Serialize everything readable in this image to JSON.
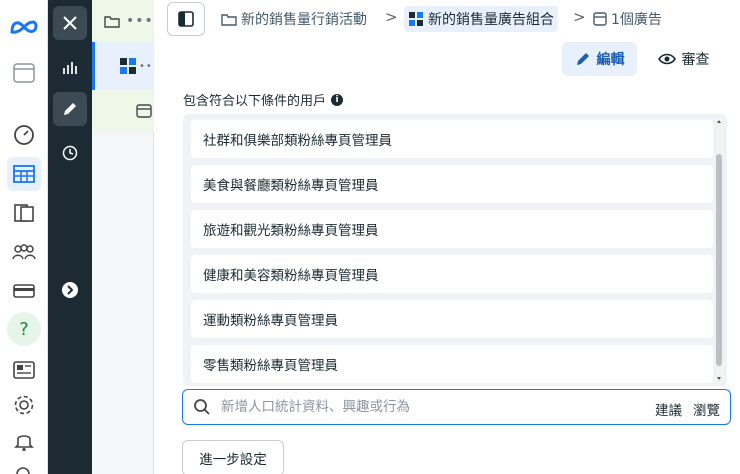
{
  "breadcrumb": {
    "campaign": "新的銷售量行銷活動",
    "adset": "新的銷售量廣告組合",
    "ads": "1個廣告"
  },
  "toolbar": {
    "edit_label": "編輯",
    "review_label": "審查"
  },
  "audience": {
    "include_label": "包含符合以下條件的用戶",
    "items": [
      "社群和俱樂部類粉絲專頁管理員",
      "美食與餐廳類粉絲專頁管理員",
      "旅遊和觀光類粉絲專頁管理員",
      "健康和美容類粉絲專頁管理員",
      "運動類粉絲專頁管理員",
      "零售類粉絲專頁管理員"
    ],
    "search_placeholder": "新增人口統計資料、興趣或行為",
    "suggest_label": "建議",
    "browse_label": "瀏覽",
    "advanced_button": "進一步設定"
  },
  "colors": {
    "brand_blue": "#1877f2",
    "dark_strip": "#1c2b33",
    "selected_bg": "#e7f0fb"
  }
}
